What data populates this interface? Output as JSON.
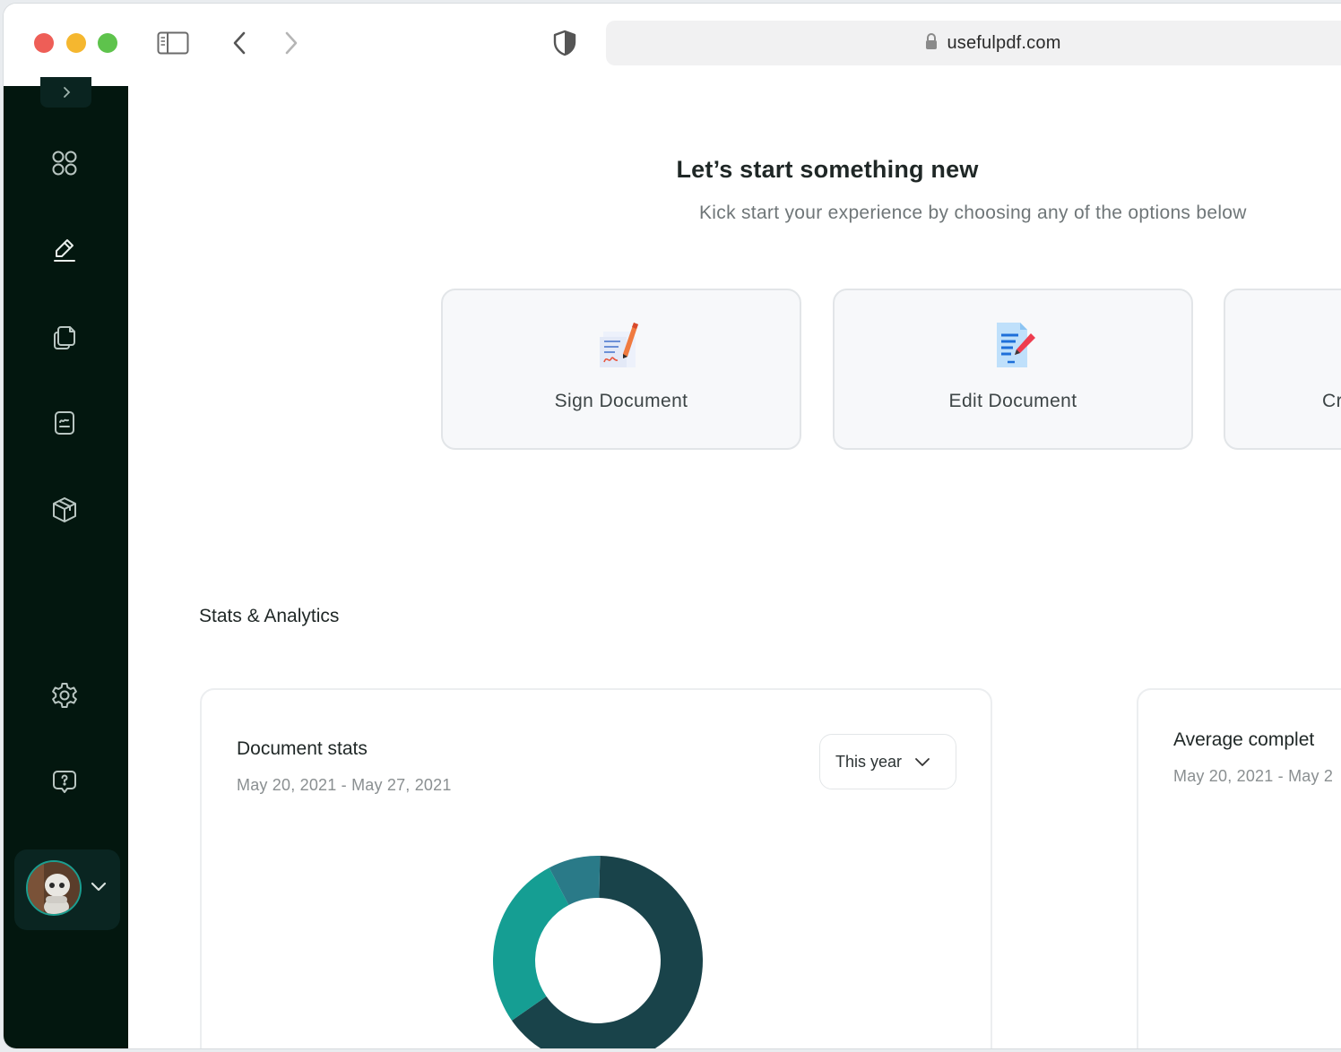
{
  "browser": {
    "url": "usefulpdf.com"
  },
  "sidebar": {
    "items": [
      {
        "name": "dashboard-icon"
      },
      {
        "name": "sign-pen-icon"
      },
      {
        "name": "documents-icon"
      },
      {
        "name": "file-edit-icon"
      },
      {
        "name": "box-icon"
      },
      {
        "name": "settings-gear-icon"
      },
      {
        "name": "help-chat-icon"
      }
    ]
  },
  "hero": {
    "title": "Let’s start something new",
    "subtitle": "Kick start your experience by choosing any of the options below"
  },
  "actions": [
    {
      "label": "Sign Document",
      "icon": "sign-document-icon"
    },
    {
      "label": "Edit Document",
      "icon": "edit-document-icon"
    },
    {
      "label": "Cr",
      "icon": "create-document-icon"
    }
  ],
  "stats": {
    "section_title": "Stats & Analytics",
    "document_stats": {
      "title": "Document stats",
      "range": "May 20, 2021 - May 27, 2021",
      "period": "This year"
    },
    "average": {
      "title": "Average complet",
      "range": "May 20, 2021 - May 2"
    }
  },
  "chart_data": {
    "type": "pie",
    "donut": true,
    "title": "",
    "slices": [
      {
        "value": 65,
        "color": "#19434a"
      },
      {
        "value": 27,
        "color": "#159e93"
      },
      {
        "value": 8,
        "color": "#2a7a88"
      }
    ]
  },
  "colors": {
    "sidebar_bg": "#03170f",
    "accent_teal": "#159e93",
    "dark_teal": "#19434a"
  }
}
